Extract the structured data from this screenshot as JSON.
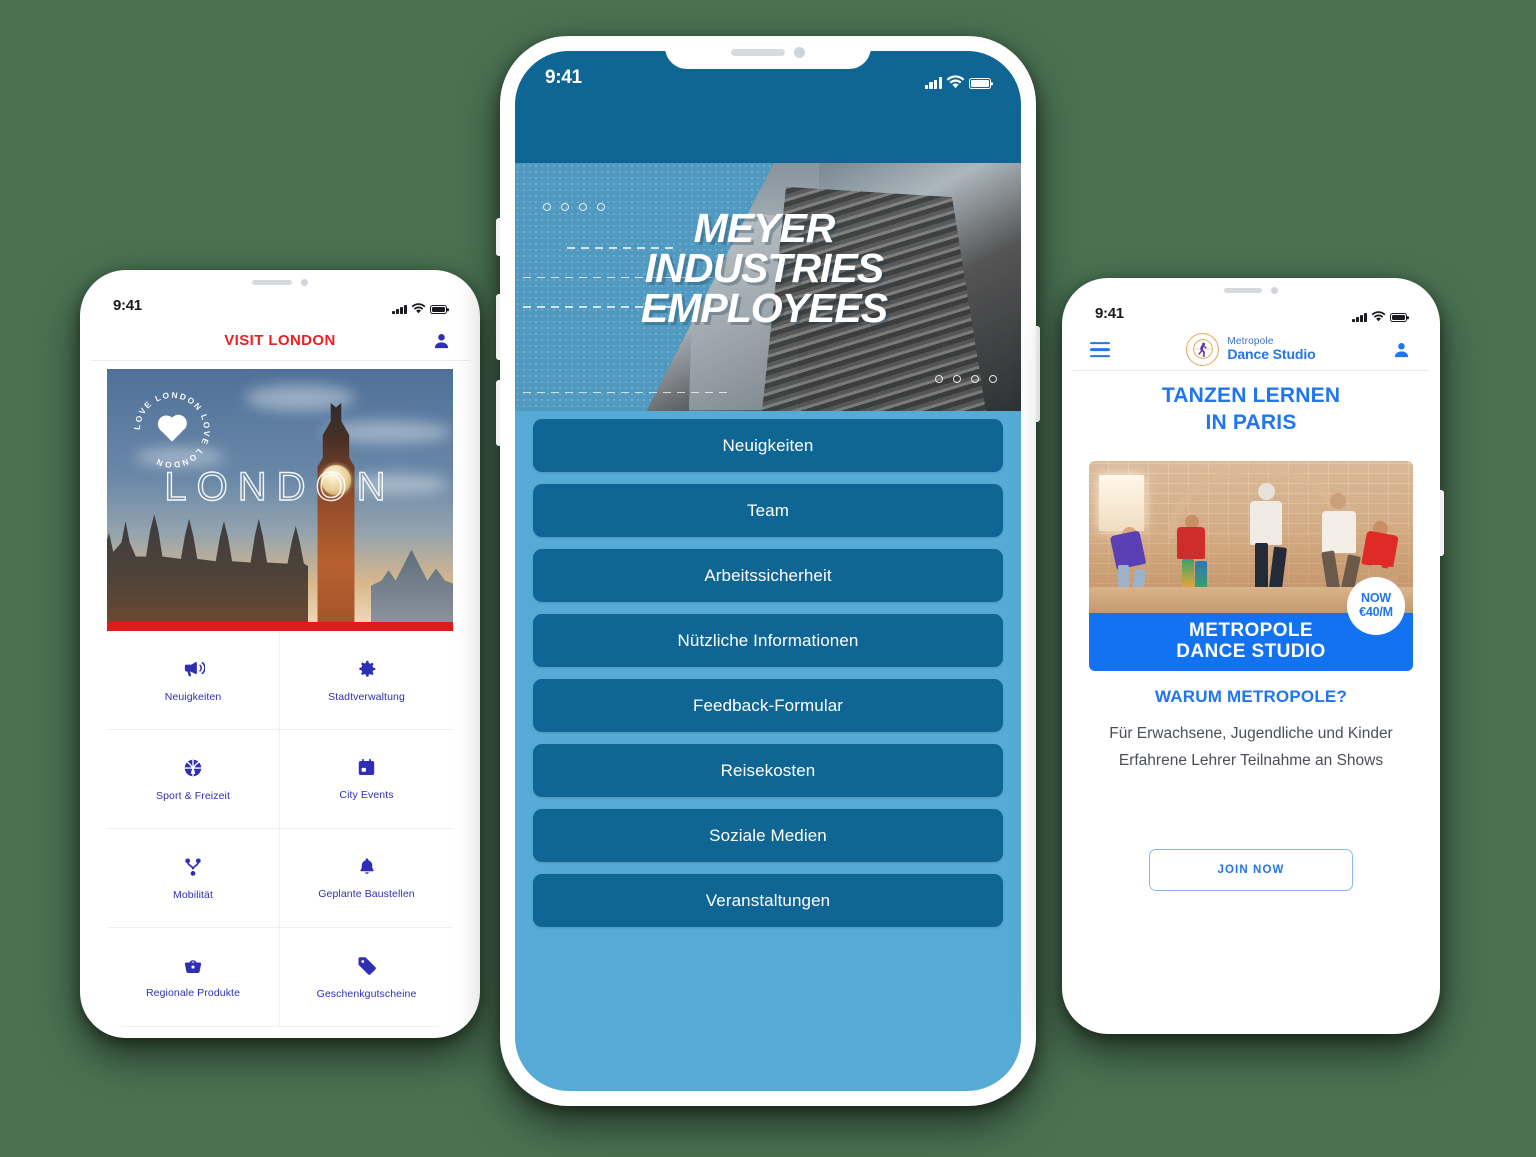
{
  "background_color": "#4a7252",
  "phones": {
    "london": {
      "status": {
        "time": "9:41",
        "icons": [
          "signal-icon",
          "wifi-icon",
          "battery-icon"
        ]
      },
      "appbar": {
        "title": "VISIT LONDON",
        "account_icon": "user-icon",
        "title_color": "#ec2024"
      },
      "hero": {
        "word": "LONDON",
        "badge_text": "LOVE LONDON LOVE LONDON ",
        "badge_icon": "heart-icon",
        "accent_bar_color": "#e01b19"
      },
      "grid": [
        {
          "label": "Neuigkeiten",
          "icon": "megaphone-icon"
        },
        {
          "label": "Stadtverwaltung",
          "icon": "gear-icon"
        },
        {
          "label": "Sport & Freizeit",
          "icon": "basketball-icon"
        },
        {
          "label": "City Events",
          "icon": "calendar-icon"
        },
        {
          "label": "Mobilität",
          "icon": "share-nodes-icon"
        },
        {
          "label": "Geplante Baustellen",
          "icon": "bell-icon"
        },
        {
          "label": "Regionale Produkte",
          "icon": "basket-icon"
        },
        {
          "label": "Geschenkgutscheine",
          "icon": "tag-icon"
        }
      ],
      "accent_color": "#2f2fb5"
    },
    "meyer": {
      "status": {
        "time": "9:41",
        "icons": [
          "signal-icon",
          "wifi-icon",
          "battery-icon"
        ]
      },
      "brand": {
        "line1": "MEYER INDUSTRIES",
        "line2": "EMPLOYEES",
        "logo_icon": "meyer-blocks-icon",
        "account_icon": "user-icon"
      },
      "hero": {
        "title_lines": [
          "MEYER",
          "INDUSTRIES",
          "EMPLOYEES"
        ]
      },
      "menu": [
        "Neuigkeiten",
        "Team",
        "Arbeitssicherheit",
        "Nützliche Informationen",
        "Feedback-Formular",
        "Reisekosten",
        "Soziale Medien",
        "Veranstaltungen"
      ],
      "colors": {
        "header": "#0f6694",
        "hero_bg": "#56aad6",
        "button": "#0f6694"
      }
    },
    "dance": {
      "status": {
        "time": "9:41",
        "icons": [
          "signal-icon",
          "wifi-icon",
          "battery-icon"
        ]
      },
      "appbar": {
        "menu_icon": "hamburger-icon",
        "logo_top": "Metropole",
        "logo_bottom": "Dance Studio",
        "logo_icon": "dancer-circle-icon",
        "account_icon": "user-icon"
      },
      "headline_lines": [
        "TANZEN LERNEN",
        "IN PARIS"
      ],
      "card": {
        "banner_lines": [
          "METROPOLE",
          "DANCE STUDIO"
        ],
        "price_lines": [
          "NOW",
          "€40/M"
        ],
        "photo_alt": "dance-class-photo"
      },
      "why_title": "WARUM METROPOLE?",
      "description": "Für Erwachsene, Jugendliche und Kinder Erfahrene Lehrer Teilnahme an Shows",
      "cta_label": "JOIN NOW",
      "accent_color": "#2176f0"
    }
  }
}
